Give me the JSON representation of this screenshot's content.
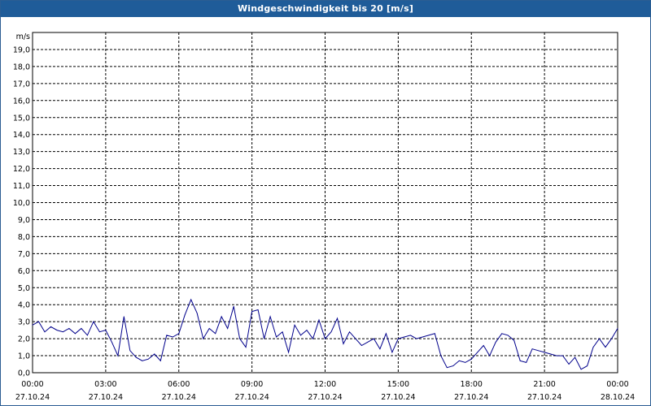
{
  "window": {
    "title": "Windgeschwindigkeit bis 20 [m/s]"
  },
  "chart_data": {
    "type": "line",
    "title": "Windgeschwindigkeit bis 20 [m/s]",
    "ylabel": "m/s",
    "ylim": [
      0,
      20
    ],
    "yticks": [
      "0,0",
      "1,0",
      "2,0",
      "3,0",
      "4,0",
      "5,0",
      "6,0",
      "7,0",
      "8,0",
      "9,0",
      "10,0",
      "11,0",
      "12,0",
      "13,0",
      "14,0",
      "15,0",
      "16,0",
      "17,0",
      "18,0",
      "19,0"
    ],
    "xlim": [
      "2024-10-27 00:00",
      "2024-10-28 00:00"
    ],
    "xticks": [
      {
        "time": "00:00",
        "date": "27.10.24"
      },
      {
        "time": "03:00",
        "date": "27.10.24"
      },
      {
        "time": "06:00",
        "date": "27.10.24"
      },
      {
        "time": "09:00",
        "date": "27.10.24"
      },
      {
        "time": "12:00",
        "date": "27.10.24"
      },
      {
        "time": "15:00",
        "date": "27.10.24"
      },
      {
        "time": "18:00",
        "date": "27.10.24"
      },
      {
        "time": "21:00",
        "date": "27.10.24"
      },
      {
        "time": "00:00",
        "date": "28.10.24"
      }
    ],
    "grid": true,
    "series": [
      {
        "color": "#00008b",
        "x_hours": [
          0,
          0.25,
          0.5,
          0.75,
          1,
          1.25,
          1.5,
          1.75,
          2,
          2.25,
          2.5,
          2.75,
          3,
          3.25,
          3.5,
          3.75,
          4,
          4.25,
          4.5,
          4.75,
          5,
          5.25,
          5.5,
          5.75,
          6,
          6.25,
          6.5,
          6.75,
          7,
          7.25,
          7.5,
          7.75,
          8,
          8.25,
          8.5,
          8.75,
          9,
          9.25,
          9.5,
          9.75,
          10,
          10.25,
          10.5,
          10.75,
          11,
          11.25,
          11.5,
          11.75,
          12,
          12.25,
          12.5,
          12.75,
          13,
          13.25,
          13.5,
          13.75,
          14,
          14.25,
          14.5,
          14.75,
          15,
          15.25,
          15.5,
          15.75,
          16,
          16.25,
          16.5,
          16.75,
          17,
          17.25,
          17.5,
          17.75,
          18,
          18.25,
          18.5,
          18.75,
          19,
          19.25,
          19.5,
          19.75,
          20,
          20.25,
          20.5,
          20.75,
          21,
          21.25,
          21.5,
          21.75,
          22,
          22.25,
          22.5,
          22.75,
          23,
          23.25,
          23.5,
          23.75,
          24
        ],
        "y": [
          2.8,
          3.0,
          2.4,
          2.7,
          2.5,
          2.4,
          2.6,
          2.3,
          2.6,
          2.2,
          3.0,
          2.4,
          2.5,
          1.8,
          1.0,
          3.3,
          1.3,
          0.9,
          0.7,
          0.8,
          1.1,
          0.7,
          2.2,
          2.1,
          2.3,
          3.4,
          4.3,
          3.5,
          2.0,
          2.6,
          2.3,
          3.3,
          2.6,
          3.9,
          2.0,
          1.5,
          3.6,
          3.7,
          2.0,
          3.3,
          2.1,
          2.4,
          1.2,
          2.8,
          2.2,
          2.5,
          2.0,
          3.1,
          2.0,
          2.4,
          3.2,
          1.7,
          2.4,
          2.0,
          1.6,
          1.8,
          2.0,
          1.4,
          2.3,
          1.2,
          2.0,
          2.1,
          2.2,
          2.0,
          2.1,
          2.2,
          2.3,
          1.0,
          0.3,
          0.4,
          0.7,
          0.6,
          0.8,
          1.2,
          1.6,
          1.0,
          1.8,
          2.3,
          2.2,
          1.9,
          0.7,
          0.6,
          1.4,
          1.3,
          1.2,
          1.1,
          1.0,
          1.0,
          0.5,
          0.9,
          0.2,
          0.4,
          1.5,
          2.0,
          1.5,
          2.0,
          2.6
        ]
      }
    ]
  }
}
